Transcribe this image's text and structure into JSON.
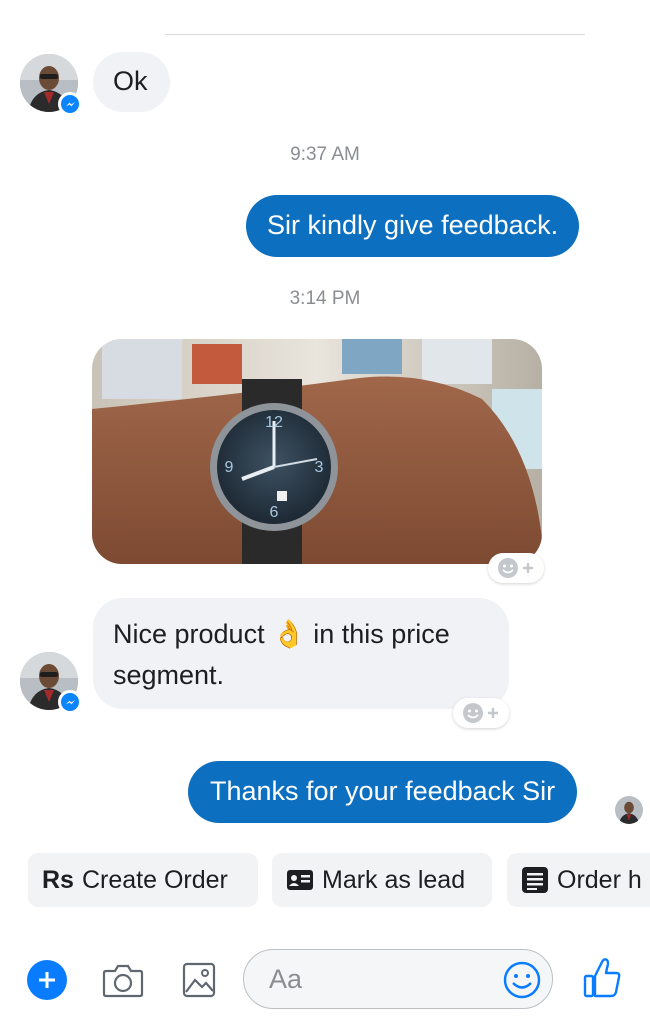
{
  "messages": {
    "msg1": "Ok",
    "time1": "9:37 AM",
    "msg2": "Sir kindly give feedback.",
    "time2": "3:14 PM",
    "msg3_line1": "Nice product",
    "msg3_emoji": "👌",
    "msg3_line1b": "in this price",
    "msg3_line2": "segment.",
    "msg4": "Thanks for your feedback Sir"
  },
  "quick_replies": {
    "create_order_icon": "Rs",
    "create_order": "Create Order",
    "mark_as_lead": "Mark as lead",
    "order_history": "Order h"
  },
  "composer": {
    "placeholder": "Aa"
  },
  "colors": {
    "outgoing_bubble": "#0d6fbf",
    "incoming_bubble": "#f0f2f5",
    "accent": "#0a84ff"
  },
  "icons": [
    "messenger-badge-icon",
    "plus-icon",
    "camera-icon",
    "gallery-icon",
    "emoji-icon",
    "thumbs-up-icon",
    "add-reaction-icon",
    "id-card-icon",
    "list-icon"
  ]
}
